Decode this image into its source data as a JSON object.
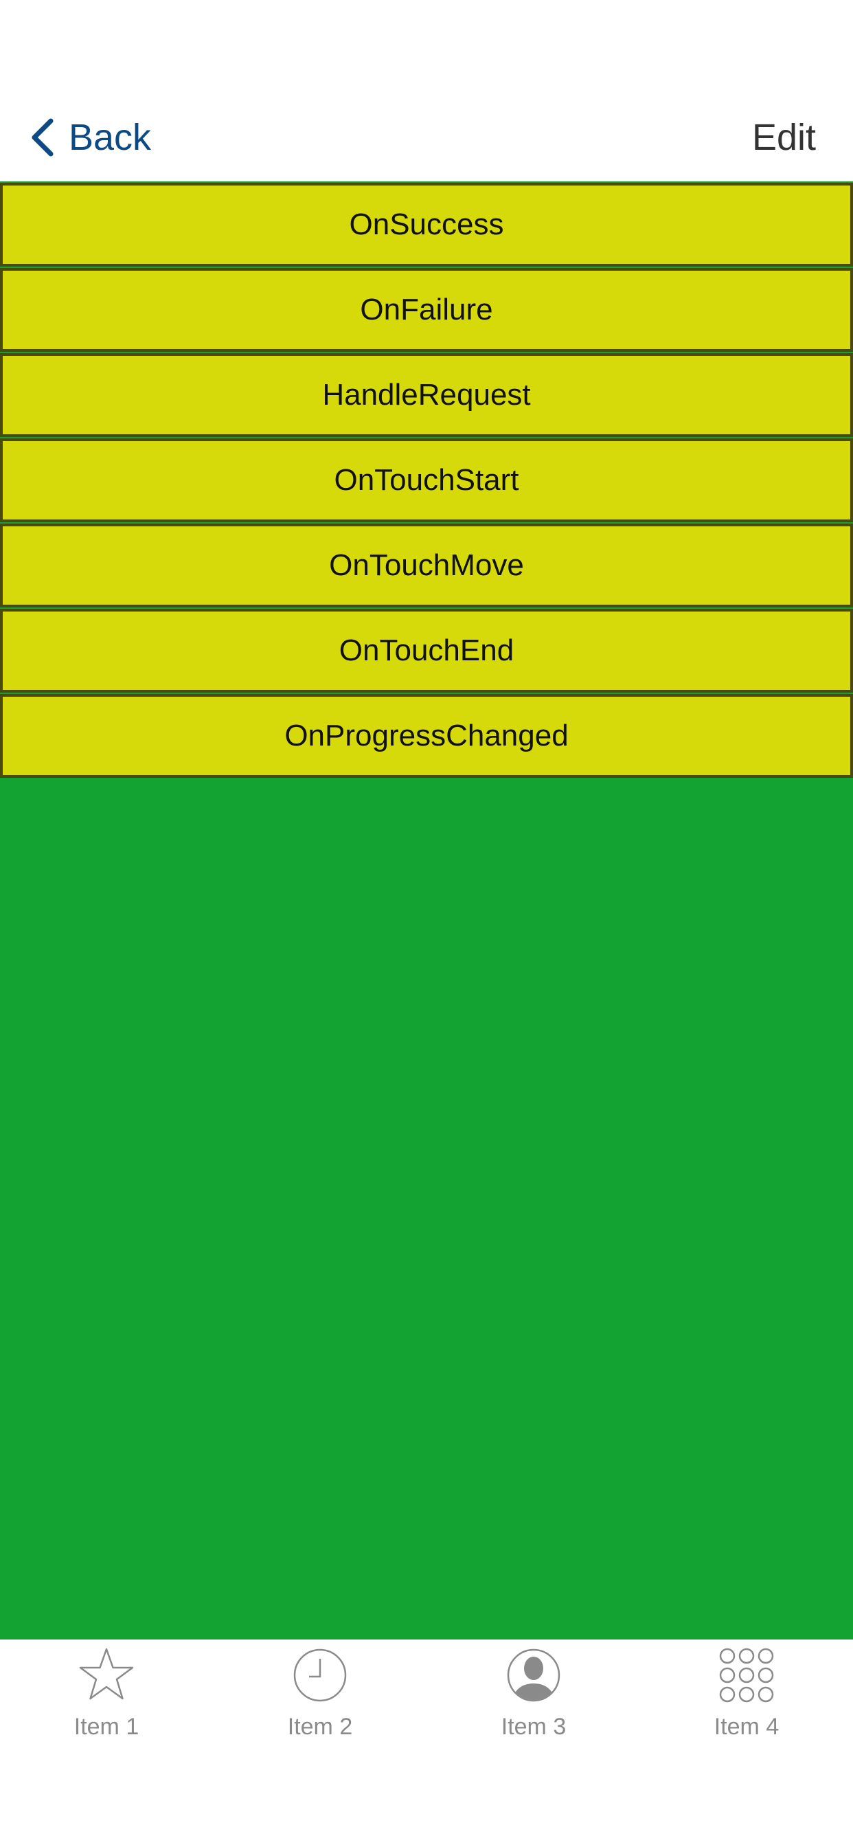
{
  "navbar": {
    "back_label": "Back",
    "edit_label": "Edit"
  },
  "events": [
    {
      "label": "OnSuccess"
    },
    {
      "label": "OnFailure"
    },
    {
      "label": "HandleRequest"
    },
    {
      "label": "OnTouchStart"
    },
    {
      "label": "OnTouchMove"
    },
    {
      "label": "OnTouchEnd"
    },
    {
      "label": "OnProgressChanged"
    }
  ],
  "tabbar": {
    "items": [
      {
        "label": "Item 1",
        "icon": "star-icon"
      },
      {
        "label": "Item 2",
        "icon": "clock-icon"
      },
      {
        "label": "Item 3",
        "icon": "person-icon"
      },
      {
        "label": "Item 4",
        "icon": "grid-icon"
      }
    ]
  },
  "colors": {
    "accent": "#0d4a84",
    "content_background": "#13a332",
    "row_background": "#d7da0a",
    "row_border": "#4a4a0e",
    "tab_inactive": "#8a8a8a"
  }
}
